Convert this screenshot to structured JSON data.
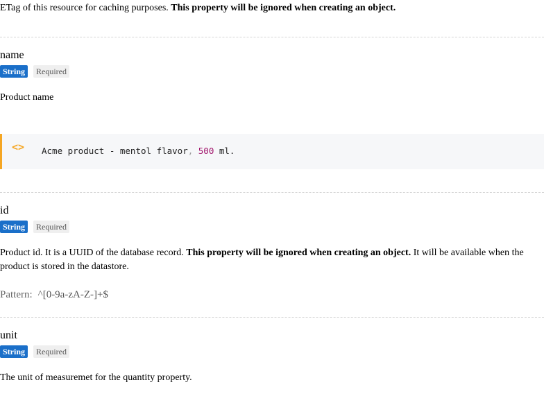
{
  "etag": {
    "text": "ETag of this resource for caching purposes. ",
    "bold": "This property will be ignored when creating an object."
  },
  "name_prop": {
    "name": "name",
    "type": "String",
    "required": "Required",
    "description": "Product name",
    "example": {
      "icon": "code-icon",
      "part1": "Acme product - mentol flavor",
      "comma": ",",
      "number": "500",
      "part2": " ml."
    }
  },
  "id_prop": {
    "name": "id",
    "type": "String",
    "required": "Required",
    "description_a": "Product id. It is a UUID of the database record. ",
    "description_bold": "This property will be ignored when creating an object.",
    "description_b": " It will be available when the product is stored in the datastore.",
    "pattern_label": "Pattern:",
    "pattern_value": "^[0-9a-zA-Z-]+$"
  },
  "unit_prop": {
    "name": "unit",
    "type": "String",
    "required": "Required",
    "description": "The unit of measuremet for the quantity property."
  },
  "colors": {
    "type_badge": "#1a6fc9",
    "example_border": "#f5a623",
    "code_number": "#a0126a"
  }
}
